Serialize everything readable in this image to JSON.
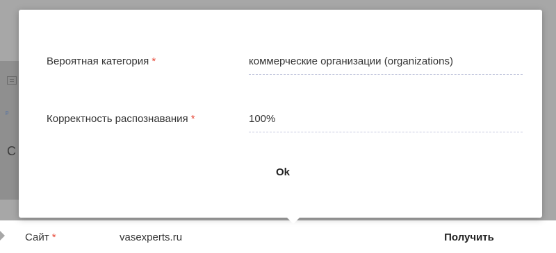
{
  "popup": {
    "fields": [
      {
        "label": "Вероятная категория",
        "required_mark": "*",
        "value": "коммерческие организации (organizations)"
      },
      {
        "label": "Корректность распознавания",
        "required_mark": "*",
        "value": "100%"
      }
    ],
    "ok_label": "Ok"
  },
  "background": {
    "left_letter": "С"
  },
  "bottom": {
    "site_label": "Сайт",
    "site_required": "*",
    "site_value": "vasexperts.ru",
    "get_label": "Получить"
  }
}
